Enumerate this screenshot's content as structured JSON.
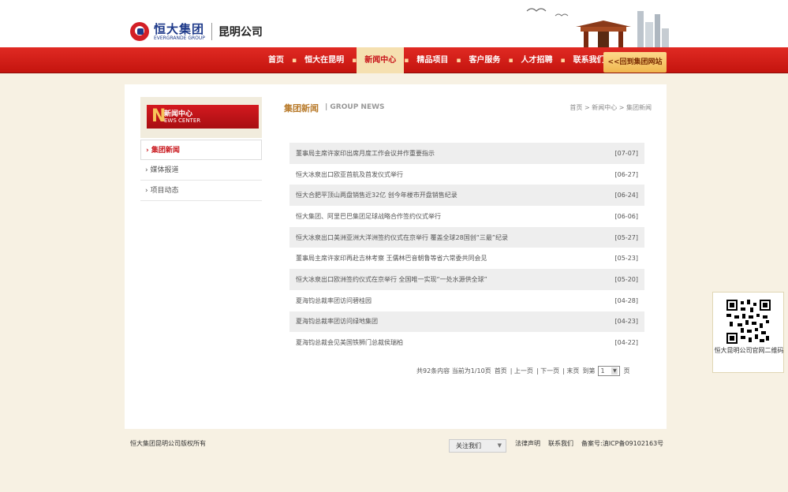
{
  "header": {
    "logo_cn": "恒大集团",
    "logo_en": "EVERGRANDE GROUP",
    "company": "昆明公司"
  },
  "nav": {
    "items": [
      "首页",
      "恒大在昆明",
      "新闻中心",
      "精品项目",
      "客户服务",
      "人才招聘",
      "联系我们"
    ],
    "active_index": 2,
    "back_button": "<<回到集团网站"
  },
  "sidebar": {
    "head_cn": "新闻中心",
    "head_en_initial": "N",
    "head_en": "EWS CENTER",
    "items": [
      {
        "label": "集团新闻",
        "active": true
      },
      {
        "label": "媒体报道",
        "active": false
      },
      {
        "label": "项目动态",
        "active": false
      }
    ]
  },
  "main": {
    "title_cn": "集团新闻",
    "title_en": "| GROUP NEWS",
    "breadcrumb": "首页 > 新闻中心 > 集团新闻"
  },
  "news": [
    {
      "title": "董事局主席许家印出席月度工作会议并作重要指示",
      "date": "[07-07]"
    },
    {
      "title": "恒大冰泉出口欧亚首航及首发仪式举行",
      "date": "[06-27]"
    },
    {
      "title": "恒大合肥平顶山两盘销售近32亿 创今年楼市开盘销售纪录",
      "date": "[06-24]"
    },
    {
      "title": "恒大集团、阿里巴巴集团足球战略合作签约仪式举行",
      "date": "[06-06]"
    },
    {
      "title": "恒大冰泉出口美洲亚洲大洋洲签约仪式在京举行 覆盖全球28国创“三最”纪录",
      "date": "[05-27]"
    },
    {
      "title": "董事局主席许家印再赴吉林考察 王儒林巴音朝鲁等省六常委共同会见",
      "date": "[05-23]"
    },
    {
      "title": "恒大冰泉出口欧洲签约仪式在京举行 全国唯一实现“一处水源供全球”",
      "date": "[05-20]"
    },
    {
      "title": "夏海钧总裁率团访问碧桂园",
      "date": "[04-28]"
    },
    {
      "title": "夏海钧总裁率团访问绿地集团",
      "date": "[04-23]"
    },
    {
      "title": "夏海钧总裁会见美国铁狮门总裁侯瑞柏",
      "date": "[04-22]"
    }
  ],
  "pager": {
    "summary": "共92条内容 当前为1/10页",
    "first": "首页",
    "prev": "| 上一页",
    "next": "| 下一页",
    "last": "| 末页",
    "goto": "到第",
    "page_value": "1",
    "page_unit": "页"
  },
  "footer": {
    "copyright": "恒大集团昆明公司版权所有",
    "follow": "关注我们",
    "links": [
      "法律声明",
      "联系我们",
      "备案号:滇ICP备09102163号"
    ]
  },
  "qr": {
    "caption": "恒大昆明公司官网二维码"
  },
  "colors": {
    "brand_red": "#d31f26",
    "accent_gold": "#b87a2a",
    "page_bg": "#f7f1e3"
  }
}
